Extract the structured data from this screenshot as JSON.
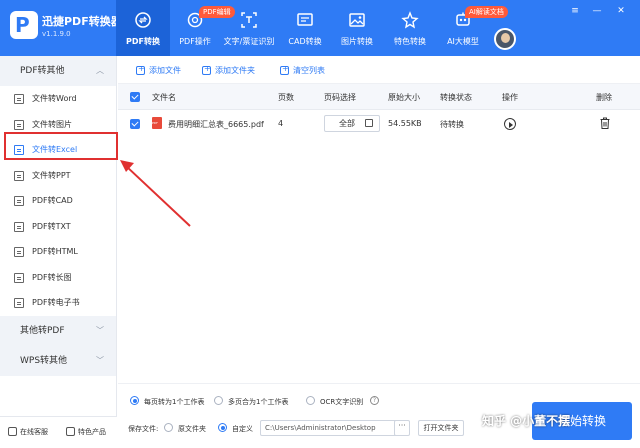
{
  "app": {
    "name": "迅捷PDF转换器",
    "version": "v1.1.9.0",
    "logo_letter": "P"
  },
  "colors": {
    "accent": "#2f7bf5",
    "topbar": "#2f7bf5",
    "badge": "#ff5a3a",
    "annotation": "#e03030"
  },
  "nav": [
    {
      "label": "PDF转换",
      "icon": "convert-icon",
      "active": true,
      "badge": ""
    },
    {
      "label": "PDF操作",
      "icon": "pdf-operate-icon",
      "active": false,
      "badge": "PDF编辑"
    },
    {
      "label": "文字/票证识别",
      "icon": "ocr-icon",
      "active": false,
      "badge": ""
    },
    {
      "label": "CAD转换",
      "icon": "cad-icon",
      "active": false,
      "badge": ""
    },
    {
      "label": "图片转换",
      "icon": "image-icon",
      "active": false,
      "badge": ""
    },
    {
      "label": "特色转换",
      "icon": "special-icon",
      "active": false,
      "badge": ""
    },
    {
      "label": "AI大模型",
      "icon": "ai-icon",
      "active": false,
      "badge": "AI解读文档"
    }
  ],
  "window_controls": {
    "menu": "≡",
    "minimize": "—",
    "close": "✕"
  },
  "sidebar": {
    "categories": [
      {
        "label": "PDF转其他",
        "expanded": true
      },
      {
        "label": "其他转PDF",
        "expanded": false
      },
      {
        "label": "WPS转其他",
        "expanded": false
      }
    ],
    "items": [
      {
        "label": "文件转Word",
        "active": false
      },
      {
        "label": "文件转图片",
        "active": false
      },
      {
        "label": "文件转Excel",
        "active": true
      },
      {
        "label": "文件转PPT",
        "active": false
      },
      {
        "label": "PDF转CAD",
        "active": false
      },
      {
        "label": "PDF转TXT",
        "active": false
      },
      {
        "label": "PDF转HTML",
        "active": false
      },
      {
        "label": "PDF转长图",
        "active": false
      },
      {
        "label": "PDF转电子书",
        "active": false
      }
    ],
    "bottom": {
      "support": "在线客服",
      "products": "特色产品"
    }
  },
  "toolbar": {
    "add_file": "添加文件",
    "add_folder": "添加文件夹",
    "clear_list": "清空列表"
  },
  "table": {
    "headers": {
      "name": "文件名",
      "pages": "页数",
      "page_select": "页码选择",
      "size": "原始大小",
      "status": "转换状态",
      "action": "操作",
      "delete": "删除"
    },
    "rows": [
      {
        "name": "费用明细汇总表_6665.pdf",
        "pages": "4",
        "page_select": "全部",
        "size": "54.55KB",
        "status": "待转换"
      }
    ]
  },
  "settings": {
    "opt1": "每页转为1个工作表",
    "opt2": "多页合为1个工作表",
    "opt3": "OCR文字识别",
    "save_label": "保存文件:",
    "save_original": "原文件夹",
    "save_custom": "自定义",
    "path": "C:\\Users\\Administrator\\Desktop",
    "browse": "···",
    "open_folder": "打开文件夹",
    "start": "开始转换"
  },
  "watermark": "知乎 @小董不摆"
}
